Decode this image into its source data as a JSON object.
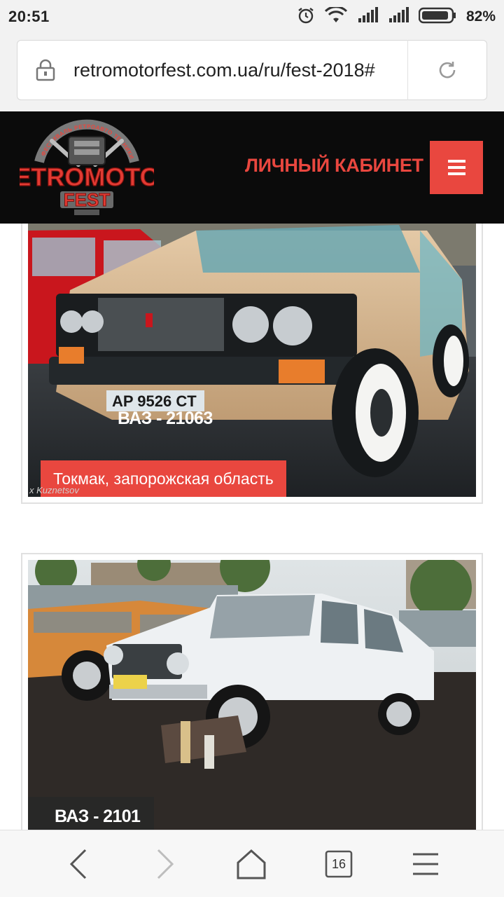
{
  "status_bar": {
    "time": "20:51",
    "battery": "82%"
  },
  "browser": {
    "url": "retromotorfest.com.ua/ru/fest-2018#",
    "tabs_count": "16"
  },
  "site": {
    "logo_text": "RETROMOTOR",
    "logo_sub": "FEST",
    "logo_arc": "ФЕСТИВАЛЬ РЕТРОАВТО ТЕХНИКИ",
    "cabinet_label": "ЛИЧНЫЙ КАБИНЕТ"
  },
  "cards": [
    {
      "car": "ВАЗ - 21063",
      "city": "Токмак, запорожская область",
      "plate": "AP 9526 CT",
      "watermark": "x Kuznetsov"
    },
    {
      "car": "ВАЗ - 2101"
    }
  ],
  "colors": {
    "accent": "#e9473f",
    "header_bg": "#0b0b0b"
  }
}
